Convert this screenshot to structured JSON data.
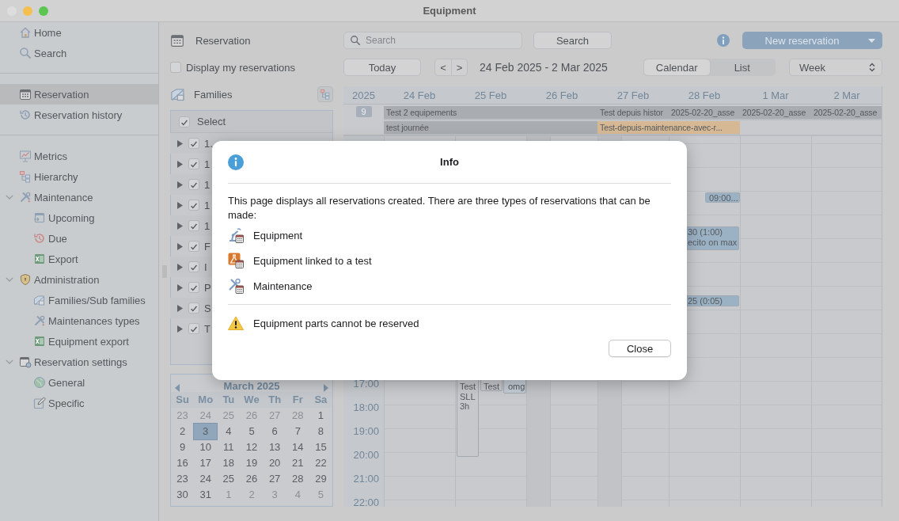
{
  "window": {
    "title": "Equipment"
  },
  "sidebar": {
    "sections": [
      {
        "items": [
          {
            "label": "Home",
            "selected": false
          },
          {
            "label": "Search",
            "selected": false
          }
        ]
      },
      {
        "items": [
          {
            "label": "Reservation",
            "selected": true
          },
          {
            "label": "Reservation history",
            "selected": false
          }
        ]
      },
      {
        "items": [
          {
            "label": "Metrics",
            "selected": false
          },
          {
            "label": "Hierarchy",
            "selected": false
          },
          {
            "label": "Maintenance",
            "selected": false,
            "expanded": true,
            "children": [
              {
                "label": "Upcoming",
                "selected": false
              },
              {
                "label": "Due",
                "selected": false
              },
              {
                "label": "Export",
                "selected": false
              }
            ]
          },
          {
            "label": "Administration",
            "selected": false,
            "expanded": true,
            "children": [
              {
                "label": "Families/Sub families",
                "selected": false
              },
              {
                "label": "Maintenances types",
                "selected": false
              },
              {
                "label": "Equipment export",
                "selected": false
              }
            ]
          },
          {
            "label": "Reservation settings",
            "selected": false,
            "expanded": true,
            "children": [
              {
                "label": "General",
                "selected": false
              },
              {
                "label": "Specific",
                "selected": false
              }
            ]
          }
        ]
      }
    ]
  },
  "toolbar": {
    "title": "Reservation",
    "search": {
      "placeholder": "Search"
    },
    "search_button": "Search",
    "new_button": "New reservation",
    "my_reservations": {
      "label": "Display my reservations",
      "checked": false
    },
    "today_button": "Today",
    "prev_button": "<",
    "next_button": ">",
    "date_range": "24 Feb 2025 - 2 Mar 2025",
    "view_tabs": [
      {
        "label": "Calendar",
        "selected": true
      },
      {
        "label": "List",
        "selected": false
      }
    ],
    "period": "Week"
  },
  "families": {
    "title": "Families",
    "select_all": {
      "label": "Select",
      "checked": true
    },
    "items": [
      {
        "label": "1.",
        "checked": true,
        "expanded": false
      },
      {
        "label": "1",
        "checked": true,
        "expanded": false
      },
      {
        "label": "1",
        "checked": true,
        "expanded": false
      },
      {
        "label": "1",
        "checked": true,
        "expanded": false
      },
      {
        "label": "1",
        "checked": true,
        "expanded": false
      },
      {
        "label": "F",
        "checked": true,
        "expanded": false
      },
      {
        "label": "I",
        "checked": true,
        "expanded": false
      },
      {
        "label": "P",
        "checked": true,
        "expanded": false
      },
      {
        "label": "S",
        "checked": true,
        "expanded": false
      },
      {
        "label": "T",
        "checked": true,
        "expanded": false
      }
    ]
  },
  "mini_calendar": {
    "title": "March 2025",
    "weekdays": [
      "Su",
      "Mo",
      "Tu",
      "We",
      "Th",
      "Fr",
      "Sa"
    ],
    "weeks": [
      [
        {
          "day": "23",
          "other_month": true,
          "selected": false
        },
        {
          "day": "24",
          "other_month": true,
          "selected": false
        },
        {
          "day": "25",
          "other_month": true,
          "selected": false
        },
        {
          "day": "26",
          "other_month": true,
          "selected": false
        },
        {
          "day": "27",
          "other_month": true,
          "selected": false
        },
        {
          "day": "28",
          "other_month": true,
          "selected": false
        },
        {
          "day": "1",
          "other_month": false,
          "selected": false
        }
      ],
      [
        {
          "day": "2",
          "other_month": false,
          "selected": false
        },
        {
          "day": "3",
          "other_month": false,
          "selected": true
        },
        {
          "day": "4",
          "other_month": false,
          "selected": false
        },
        {
          "day": "5",
          "other_month": false,
          "selected": false
        },
        {
          "day": "6",
          "other_month": false,
          "selected": false
        },
        {
          "day": "7",
          "other_month": false,
          "selected": false
        },
        {
          "day": "8",
          "other_month": false,
          "selected": false
        }
      ],
      [
        {
          "day": "9",
          "other_month": false,
          "selected": false
        },
        {
          "day": "10",
          "other_month": false,
          "selected": false
        },
        {
          "day": "11",
          "other_month": false,
          "selected": false
        },
        {
          "day": "12",
          "other_month": false,
          "selected": false
        },
        {
          "day": "13",
          "other_month": false,
          "selected": false
        },
        {
          "day": "14",
          "other_month": false,
          "selected": false
        },
        {
          "day": "15",
          "other_month": false,
          "selected": false
        }
      ],
      [
        {
          "day": "16",
          "other_month": false,
          "selected": false
        },
        {
          "day": "17",
          "other_month": false,
          "selected": false
        },
        {
          "day": "18",
          "other_month": false,
          "selected": false
        },
        {
          "day": "19",
          "other_month": false,
          "selected": false
        },
        {
          "day": "20",
          "other_month": false,
          "selected": false
        },
        {
          "day": "21",
          "other_month": false,
          "selected": false
        },
        {
          "day": "22",
          "other_month": false,
          "selected": false
        }
      ],
      [
        {
          "day": "23",
          "other_month": false,
          "selected": false
        },
        {
          "day": "24",
          "other_month": false,
          "selected": false
        },
        {
          "day": "25",
          "other_month": false,
          "selected": false
        },
        {
          "day": "26",
          "other_month": false,
          "selected": false
        },
        {
          "day": "27",
          "other_month": false,
          "selected": false
        },
        {
          "day": "28",
          "other_month": false,
          "selected": false
        },
        {
          "day": "29",
          "other_month": false,
          "selected": false
        }
      ],
      [
        {
          "day": "30",
          "other_month": false,
          "selected": false
        },
        {
          "day": "31",
          "other_month": false,
          "selected": false
        },
        {
          "day": "1",
          "other_month": true,
          "selected": false
        },
        {
          "day": "2",
          "other_month": true,
          "selected": false
        },
        {
          "day": "3",
          "other_month": true,
          "selected": false
        },
        {
          "day": "4",
          "other_month": true,
          "selected": false
        },
        {
          "day": "5",
          "other_month": true,
          "selected": false
        }
      ]
    ]
  },
  "calendar": {
    "year": "2025",
    "days": [
      "24 Feb",
      "25 Feb",
      "26 Feb",
      "27 Feb",
      "28 Feb",
      "1 Mar",
      "2 Mar"
    ],
    "week_number": "9",
    "all_day_events": [
      {
        "title": "Test 2 equipements",
        "color": "#a9acb0"
      },
      {
        "title": "Test depuis histor",
        "color": "#a9acb0"
      },
      {
        "title": "2025-02-20_asse",
        "color": "#a9acb0"
      },
      {
        "title": "2025-02-20_asse",
        "color": "#a9acb0"
      },
      {
        "title": "2025-02-20_asse",
        "color": "#a9acb0"
      },
      {
        "title": "test journée",
        "color": "#a9acb0"
      },
      {
        "title": "Test-depuis-maintenance-avec-r...",
        "color": "#d6b994"
      }
    ],
    "hours": [
      "17:00",
      "18:00",
      "19:00",
      "20:00",
      "21:00",
      "22:00"
    ],
    "events": [
      {
        "lines": [
          "09:00..."
        ],
        "color": "#9bb1c4"
      },
      {
        "lines": [
          "30 (1:00)",
          "ecito on max"
        ],
        "color": "#9bb1c4"
      },
      {
        "lines": [
          "25 (0:05)"
        ],
        "color": "#9bb1c4"
      },
      {
        "lines": [
          "Test",
          "SLL",
          "3h"
        ],
        "color": "#c6c8cb"
      },
      {
        "lines": [
          "Test"
        ],
        "color": "#c6c8cb"
      },
      {
        "lines": [
          "omg"
        ],
        "color": "#c3cbd4"
      }
    ]
  },
  "dialog": {
    "title": "Info",
    "message": "This page displays all reservations created. There are three types of reservations that can be made:",
    "types": [
      "Equipment",
      "Equipment linked to a test",
      "Maintenance"
    ],
    "warning": "Equipment parts cannot be reserved",
    "close_button": "Close"
  }
}
